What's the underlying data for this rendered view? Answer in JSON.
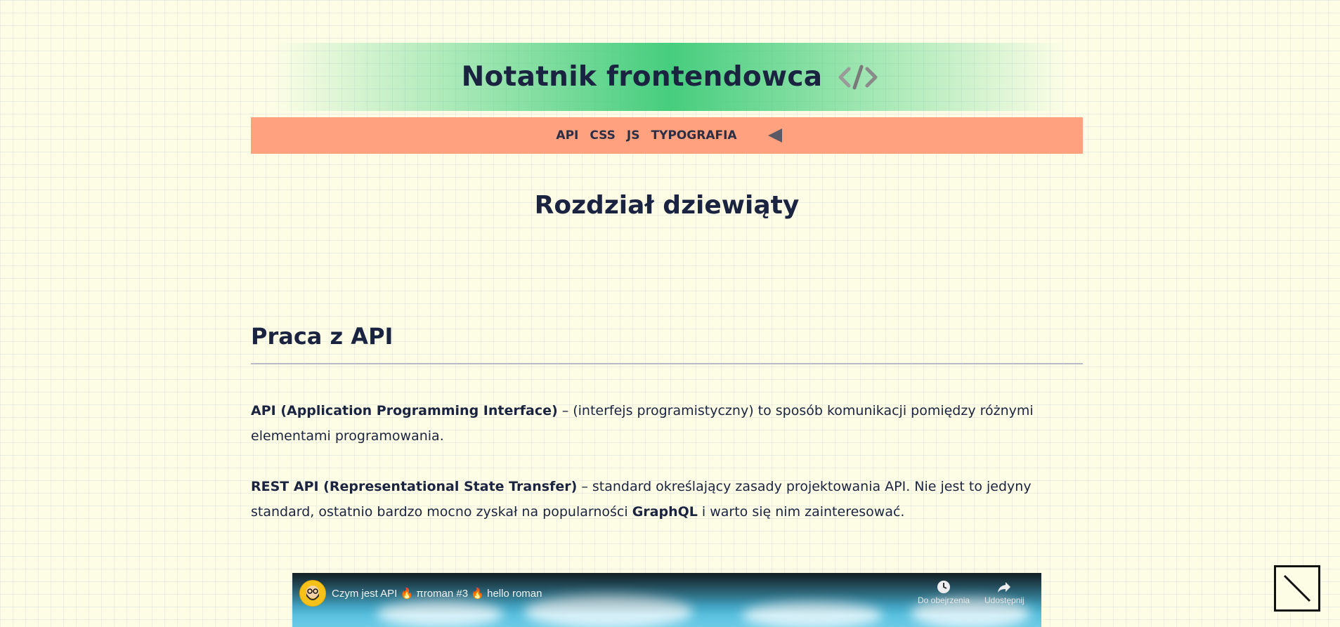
{
  "header": {
    "title": "Notatnik frontendowca",
    "icon": "code-icon"
  },
  "nav": {
    "items": [
      "API",
      "CSS",
      "JS",
      "TYPOGRAFIA"
    ],
    "toggle_icon": "triangle-left-icon"
  },
  "chapter": {
    "title": "Rozdział dziewiąty"
  },
  "section": {
    "title": "Praca z API",
    "paragraphs": [
      {
        "term": "API (Application Programming Interface)",
        "text": " – (interfejs programistyczny) to sposób komunikacji pomiędzy różnymi elementami programowania."
      },
      {
        "term": "REST API (Representational State Transfer)",
        "text_before": " – standard określający zasady projektowania API. Nie jest to jedyny standard, ostatnio bardzo mocno zyskał na popularności ",
        "highlight": "GraphQL",
        "text_after": " i warto się nim zainteresować."
      }
    ]
  },
  "video": {
    "title": "Czym jest API 🔥 πroman #3 🔥 hello roman",
    "watch_later": "Do obejrzenia",
    "share": "Udostępnij"
  },
  "colors": {
    "header_gradient": "#46cd7e",
    "nav_background": "#ffa07e",
    "text": "#1a2340",
    "page_background": "#fdfde6"
  }
}
